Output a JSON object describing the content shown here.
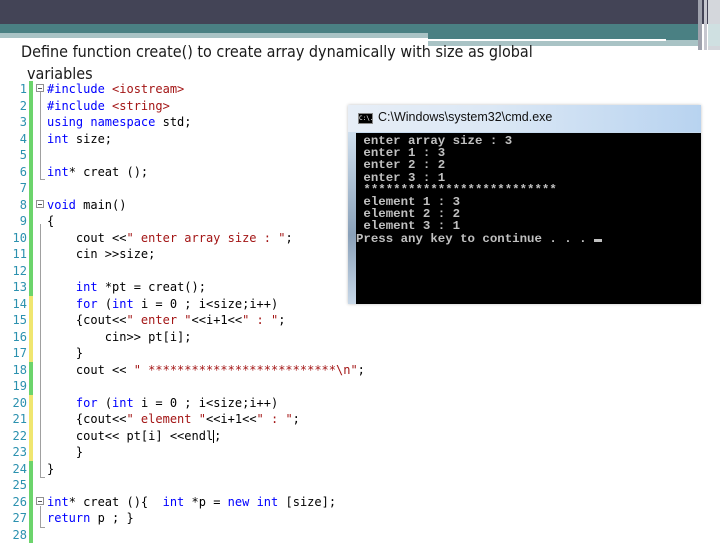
{
  "slide": {
    "title_line1": "Define function create() to create array dynamically with size as global",
    "title_line2": "variables"
  },
  "colors": {
    "header_dark": "#434456",
    "header_teal": "#4a8083",
    "keyword": "#0000ff",
    "string": "#a31515",
    "line_number": "#2b91af",
    "change_saved": "#6cd46c",
    "change_unsaved": "#f0e670"
  },
  "editor": {
    "lines": [
      {
        "n": "1",
        "change": "saved",
        "fold": true,
        "tokens": [
          {
            "t": "pp",
            "v": "#include "
          },
          {
            "t": "str",
            "v": "<iostream>"
          }
        ]
      },
      {
        "n": "2",
        "change": "saved",
        "tokens": [
          {
            "t": "pp",
            "v": "#include "
          },
          {
            "t": "str",
            "v": "<string>"
          }
        ]
      },
      {
        "n": "3",
        "change": "saved",
        "tokens": [
          {
            "t": "kw",
            "v": "using namespace"
          },
          {
            "t": "plain",
            "v": " std;"
          }
        ]
      },
      {
        "n": "4",
        "change": "saved",
        "tokens": [
          {
            "t": "kw",
            "v": "int"
          },
          {
            "t": "plain",
            "v": " size;"
          }
        ]
      },
      {
        "n": "5",
        "change": "saved",
        "tokens": []
      },
      {
        "n": "6",
        "change": "saved",
        "tokens": [
          {
            "t": "kw",
            "v": "int"
          },
          {
            "t": "plain",
            "v": "* creat ();"
          }
        ]
      },
      {
        "n": "7",
        "change": "saved",
        "tokens": []
      },
      {
        "n": "8",
        "change": "saved",
        "fold": true,
        "tokens": [
          {
            "t": "kw",
            "v": "void"
          },
          {
            "t": "plain",
            "v": " main()"
          }
        ]
      },
      {
        "n": "9",
        "change": "saved",
        "tokens": [
          {
            "t": "plain",
            "v": "{"
          }
        ]
      },
      {
        "n": "10",
        "change": "saved",
        "tokens": [
          {
            "t": "plain",
            "v": "    cout <<"
          },
          {
            "t": "str",
            "v": "\" enter array size : \""
          },
          {
            "t": "plain",
            "v": ";"
          }
        ]
      },
      {
        "n": "11",
        "change": "saved",
        "tokens": [
          {
            "t": "plain",
            "v": "    cin >>size;"
          }
        ]
      },
      {
        "n": "12",
        "change": "saved",
        "tokens": []
      },
      {
        "n": "13",
        "change": "saved",
        "tokens": [
          {
            "t": "plain",
            "v": "    "
          },
          {
            "t": "kw",
            "v": "int"
          },
          {
            "t": "plain",
            "v": " *pt = creat();"
          }
        ]
      },
      {
        "n": "14",
        "change": "unsaved",
        "tokens": [
          {
            "t": "plain",
            "v": "    "
          },
          {
            "t": "kw",
            "v": "for"
          },
          {
            "t": "plain",
            "v": " ("
          },
          {
            "t": "kw",
            "v": "int"
          },
          {
            "t": "plain",
            "v": " i = 0 ; i<size;i++)"
          }
        ]
      },
      {
        "n": "15",
        "change": "unsaved",
        "tokens": [
          {
            "t": "plain",
            "v": "    {cout<<"
          },
          {
            "t": "str",
            "v": "\" enter \""
          },
          {
            "t": "plain",
            "v": "<<i+1<<"
          },
          {
            "t": "str",
            "v": "\" : \""
          },
          {
            "t": "plain",
            "v": ";"
          }
        ]
      },
      {
        "n": "16",
        "change": "unsaved",
        "tokens": [
          {
            "t": "plain",
            "v": "        cin>> pt[i];"
          }
        ]
      },
      {
        "n": "17",
        "change": "unsaved",
        "tokens": [
          {
            "t": "plain",
            "v": "    }"
          }
        ]
      },
      {
        "n": "18",
        "change": "saved",
        "tokens": [
          {
            "t": "plain",
            "v": "    cout << "
          },
          {
            "t": "str",
            "v": "\" **************************\\n\""
          },
          {
            "t": "plain",
            "v": ";"
          }
        ]
      },
      {
        "n": "19",
        "change": "saved",
        "tokens": []
      },
      {
        "n": "20",
        "change": "unsaved",
        "tokens": [
          {
            "t": "plain",
            "v": "    "
          },
          {
            "t": "kw",
            "v": "for"
          },
          {
            "t": "plain",
            "v": " ("
          },
          {
            "t": "kw",
            "v": "int"
          },
          {
            "t": "plain",
            "v": " i = 0 ; i<size;i++)"
          }
        ]
      },
      {
        "n": "21",
        "change": "unsaved",
        "tokens": [
          {
            "t": "plain",
            "v": "    {cout<<"
          },
          {
            "t": "str",
            "v": "\" element \""
          },
          {
            "t": "plain",
            "v": "<<i+1<<"
          },
          {
            "t": "str",
            "v": "\" : \""
          },
          {
            "t": "plain",
            "v": ";"
          }
        ]
      },
      {
        "n": "22",
        "change": "unsaved",
        "caret": true,
        "tokens": [
          {
            "t": "plain",
            "v": "    cout<< pt[i] <<endl"
          },
          {
            "t": "caret",
            "v": ""
          },
          {
            "t": "plain",
            "v": ";"
          }
        ]
      },
      {
        "n": "23",
        "change": "unsaved",
        "tokens": [
          {
            "t": "plain",
            "v": "    }"
          }
        ]
      },
      {
        "n": "24",
        "change": "saved",
        "tokens": [
          {
            "t": "plain",
            "v": "}"
          }
        ]
      },
      {
        "n": "25",
        "change": "saved",
        "tokens": []
      },
      {
        "n": "26",
        "change": "saved",
        "fold": true,
        "tokens": [
          {
            "t": "kw",
            "v": "int"
          },
          {
            "t": "plain",
            "v": "* creat (){  "
          },
          {
            "t": "kw",
            "v": "int"
          },
          {
            "t": "plain",
            "v": " *p = "
          },
          {
            "t": "kw",
            "v": "new"
          },
          {
            "t": "plain",
            "v": " "
          },
          {
            "t": "kw",
            "v": "int"
          },
          {
            "t": "plain",
            "v": " [size];"
          }
        ]
      },
      {
        "n": "27",
        "change": "saved",
        "tokens": [
          {
            "t": "kw",
            "v": "return"
          },
          {
            "t": "plain",
            "v": " p ; }"
          }
        ]
      },
      {
        "n": "28",
        "change": "saved",
        "tokens": []
      }
    ]
  },
  "console": {
    "icon_label": "C:\\.",
    "title": "C:\\Windows\\system32\\cmd.exe",
    "output": [
      " enter array size : 3",
      " enter 1 : 3",
      " enter 2 : 2",
      " enter 3 : 1",
      " **************************",
      " element 1 : 3",
      " element 2 : 2",
      " element 3 : 1",
      "Press any key to continue . . . "
    ]
  }
}
